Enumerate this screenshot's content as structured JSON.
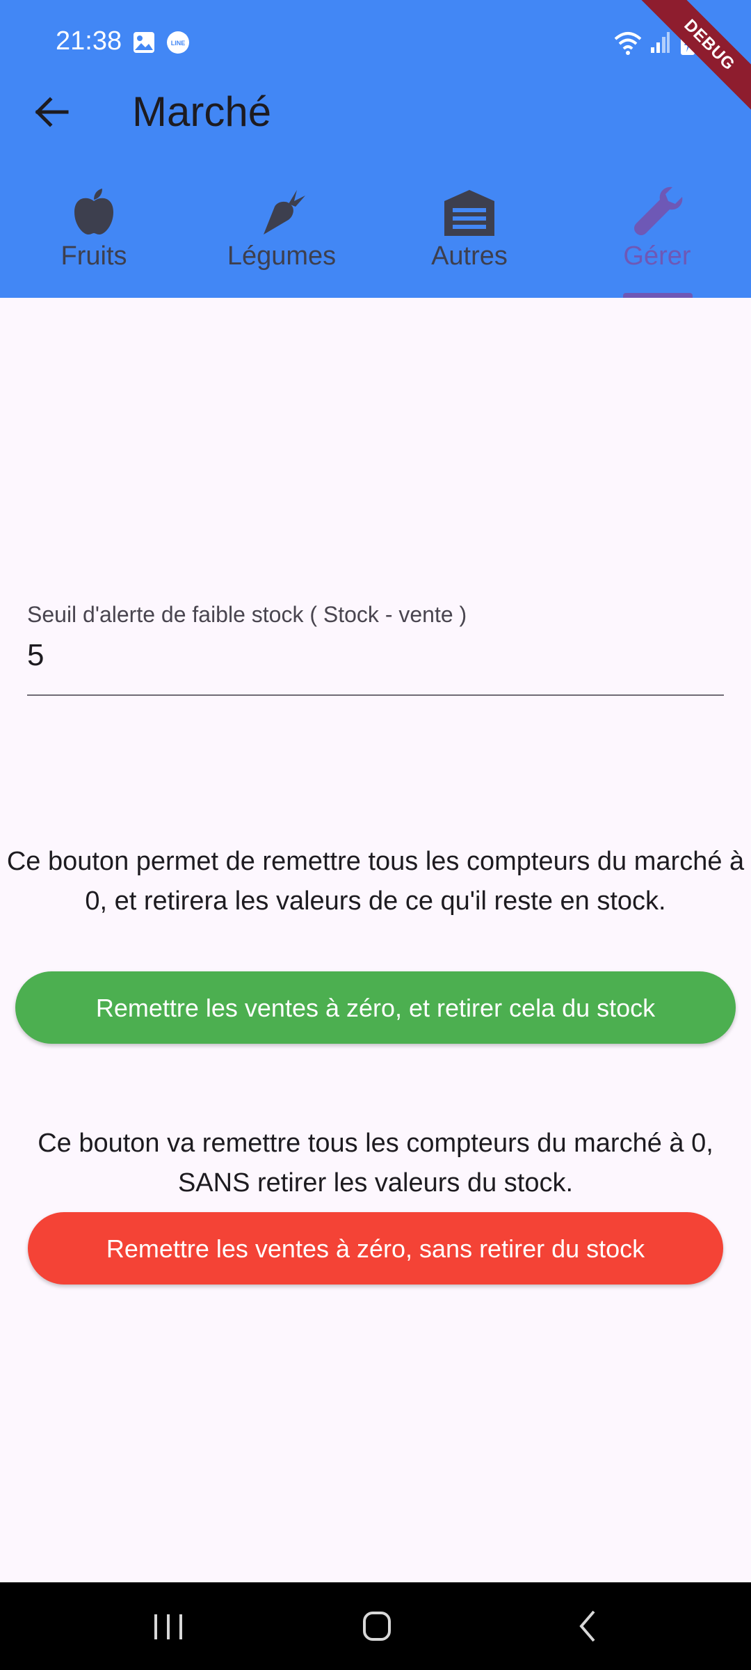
{
  "status_bar": {
    "time": "21:38",
    "left_icons": [
      "gallery-icon",
      "line-app-icon"
    ],
    "right_icons": [
      "wifi-icon",
      "signal-icon",
      "battery-charging-icon"
    ]
  },
  "debug_banner": "DEBUG",
  "app_bar": {
    "title": "Marché",
    "back_icon": "arrow-back-icon",
    "background_color": "#4287f5"
  },
  "tabs": [
    {
      "label": "Fruits",
      "icon": "apple-icon",
      "selected": false
    },
    {
      "label": "Légumes",
      "icon": "carrot-icon",
      "selected": false
    },
    {
      "label": "Autres",
      "icon": "warehouse-icon",
      "selected": false
    },
    {
      "label": "Gérer",
      "icon": "wrench-icon",
      "selected": true
    }
  ],
  "settings": {
    "threshold_field": {
      "label": "Seuil d'alerte de faible stock ( Stock - vente )",
      "value": "5"
    },
    "reset_with_stock": {
      "description": "Ce bouton permet de remettre tous les compteurs du marché à 0, et retirera les valeurs de ce qu'il reste en stock.",
      "button_label": "Remettre les ventes à zéro, et retirer cela du stock",
      "color": "#4caf50"
    },
    "reset_without_stock": {
      "description": "Ce bouton va remettre tous les compteurs du marché à 0, SANS retirer les valeurs du stock.",
      "button_label": "Remettre les ventes à zéro, sans retirer du stock",
      "color": "#f44336"
    }
  },
  "nav_bar": {
    "buttons": [
      "recent-apps-icon",
      "home-icon",
      "back-icon"
    ]
  },
  "colors": {
    "accent_selected_tab": "#6e58b6",
    "page_background": "#fdf7fe"
  }
}
